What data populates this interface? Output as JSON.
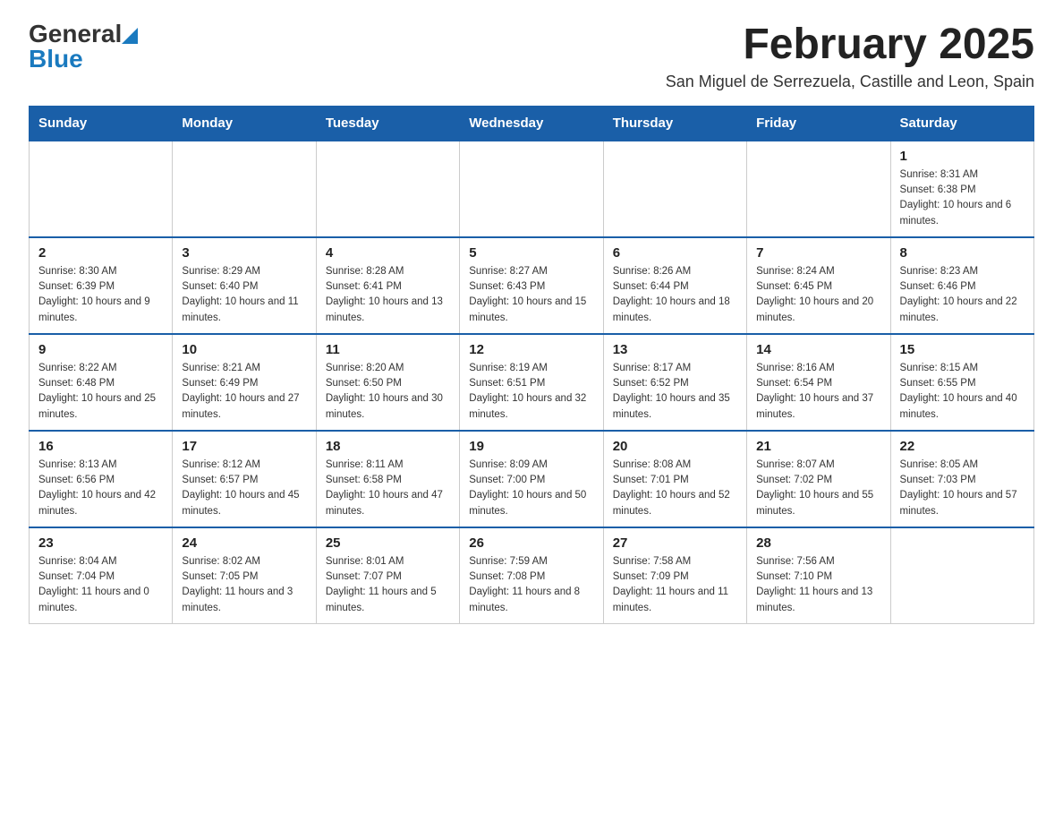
{
  "header": {
    "logo": {
      "general": "General",
      "blue": "Blue"
    },
    "title": "February 2025",
    "subtitle": "San Miguel de Serrezuela, Castille and Leon, Spain"
  },
  "calendar": {
    "days_of_week": [
      "Sunday",
      "Monday",
      "Tuesday",
      "Wednesday",
      "Thursday",
      "Friday",
      "Saturday"
    ],
    "weeks": [
      {
        "days": [
          {
            "number": "",
            "info": "",
            "empty": true
          },
          {
            "number": "",
            "info": "",
            "empty": true
          },
          {
            "number": "",
            "info": "",
            "empty": true
          },
          {
            "number": "",
            "info": "",
            "empty": true
          },
          {
            "number": "",
            "info": "",
            "empty": true
          },
          {
            "number": "",
            "info": "",
            "empty": true
          },
          {
            "number": "1",
            "info": "Sunrise: 8:31 AM\nSunset: 6:38 PM\nDaylight: 10 hours and 6 minutes.",
            "empty": false
          }
        ]
      },
      {
        "days": [
          {
            "number": "2",
            "info": "Sunrise: 8:30 AM\nSunset: 6:39 PM\nDaylight: 10 hours and 9 minutes.",
            "empty": false
          },
          {
            "number": "3",
            "info": "Sunrise: 8:29 AM\nSunset: 6:40 PM\nDaylight: 10 hours and 11 minutes.",
            "empty": false
          },
          {
            "number": "4",
            "info": "Sunrise: 8:28 AM\nSunset: 6:41 PM\nDaylight: 10 hours and 13 minutes.",
            "empty": false
          },
          {
            "number": "5",
            "info": "Sunrise: 8:27 AM\nSunset: 6:43 PM\nDaylight: 10 hours and 15 minutes.",
            "empty": false
          },
          {
            "number": "6",
            "info": "Sunrise: 8:26 AM\nSunset: 6:44 PM\nDaylight: 10 hours and 18 minutes.",
            "empty": false
          },
          {
            "number": "7",
            "info": "Sunrise: 8:24 AM\nSunset: 6:45 PM\nDaylight: 10 hours and 20 minutes.",
            "empty": false
          },
          {
            "number": "8",
            "info": "Sunrise: 8:23 AM\nSunset: 6:46 PM\nDaylight: 10 hours and 22 minutes.",
            "empty": false
          }
        ]
      },
      {
        "days": [
          {
            "number": "9",
            "info": "Sunrise: 8:22 AM\nSunset: 6:48 PM\nDaylight: 10 hours and 25 minutes.",
            "empty": false
          },
          {
            "number": "10",
            "info": "Sunrise: 8:21 AM\nSunset: 6:49 PM\nDaylight: 10 hours and 27 minutes.",
            "empty": false
          },
          {
            "number": "11",
            "info": "Sunrise: 8:20 AM\nSunset: 6:50 PM\nDaylight: 10 hours and 30 minutes.",
            "empty": false
          },
          {
            "number": "12",
            "info": "Sunrise: 8:19 AM\nSunset: 6:51 PM\nDaylight: 10 hours and 32 minutes.",
            "empty": false
          },
          {
            "number": "13",
            "info": "Sunrise: 8:17 AM\nSunset: 6:52 PM\nDaylight: 10 hours and 35 minutes.",
            "empty": false
          },
          {
            "number": "14",
            "info": "Sunrise: 8:16 AM\nSunset: 6:54 PM\nDaylight: 10 hours and 37 minutes.",
            "empty": false
          },
          {
            "number": "15",
            "info": "Sunrise: 8:15 AM\nSunset: 6:55 PM\nDaylight: 10 hours and 40 minutes.",
            "empty": false
          }
        ]
      },
      {
        "days": [
          {
            "number": "16",
            "info": "Sunrise: 8:13 AM\nSunset: 6:56 PM\nDaylight: 10 hours and 42 minutes.",
            "empty": false
          },
          {
            "number": "17",
            "info": "Sunrise: 8:12 AM\nSunset: 6:57 PM\nDaylight: 10 hours and 45 minutes.",
            "empty": false
          },
          {
            "number": "18",
            "info": "Sunrise: 8:11 AM\nSunset: 6:58 PM\nDaylight: 10 hours and 47 minutes.",
            "empty": false
          },
          {
            "number": "19",
            "info": "Sunrise: 8:09 AM\nSunset: 7:00 PM\nDaylight: 10 hours and 50 minutes.",
            "empty": false
          },
          {
            "number": "20",
            "info": "Sunrise: 8:08 AM\nSunset: 7:01 PM\nDaylight: 10 hours and 52 minutes.",
            "empty": false
          },
          {
            "number": "21",
            "info": "Sunrise: 8:07 AM\nSunset: 7:02 PM\nDaylight: 10 hours and 55 minutes.",
            "empty": false
          },
          {
            "number": "22",
            "info": "Sunrise: 8:05 AM\nSunset: 7:03 PM\nDaylight: 10 hours and 57 minutes.",
            "empty": false
          }
        ]
      },
      {
        "days": [
          {
            "number": "23",
            "info": "Sunrise: 8:04 AM\nSunset: 7:04 PM\nDaylight: 11 hours and 0 minutes.",
            "empty": false
          },
          {
            "number": "24",
            "info": "Sunrise: 8:02 AM\nSunset: 7:05 PM\nDaylight: 11 hours and 3 minutes.",
            "empty": false
          },
          {
            "number": "25",
            "info": "Sunrise: 8:01 AM\nSunset: 7:07 PM\nDaylight: 11 hours and 5 minutes.",
            "empty": false
          },
          {
            "number": "26",
            "info": "Sunrise: 7:59 AM\nSunset: 7:08 PM\nDaylight: 11 hours and 8 minutes.",
            "empty": false
          },
          {
            "number": "27",
            "info": "Sunrise: 7:58 AM\nSunset: 7:09 PM\nDaylight: 11 hours and 11 minutes.",
            "empty": false
          },
          {
            "number": "28",
            "info": "Sunrise: 7:56 AM\nSunset: 7:10 PM\nDaylight: 11 hours and 13 minutes.",
            "empty": false
          },
          {
            "number": "",
            "info": "",
            "empty": true
          }
        ]
      }
    ]
  }
}
